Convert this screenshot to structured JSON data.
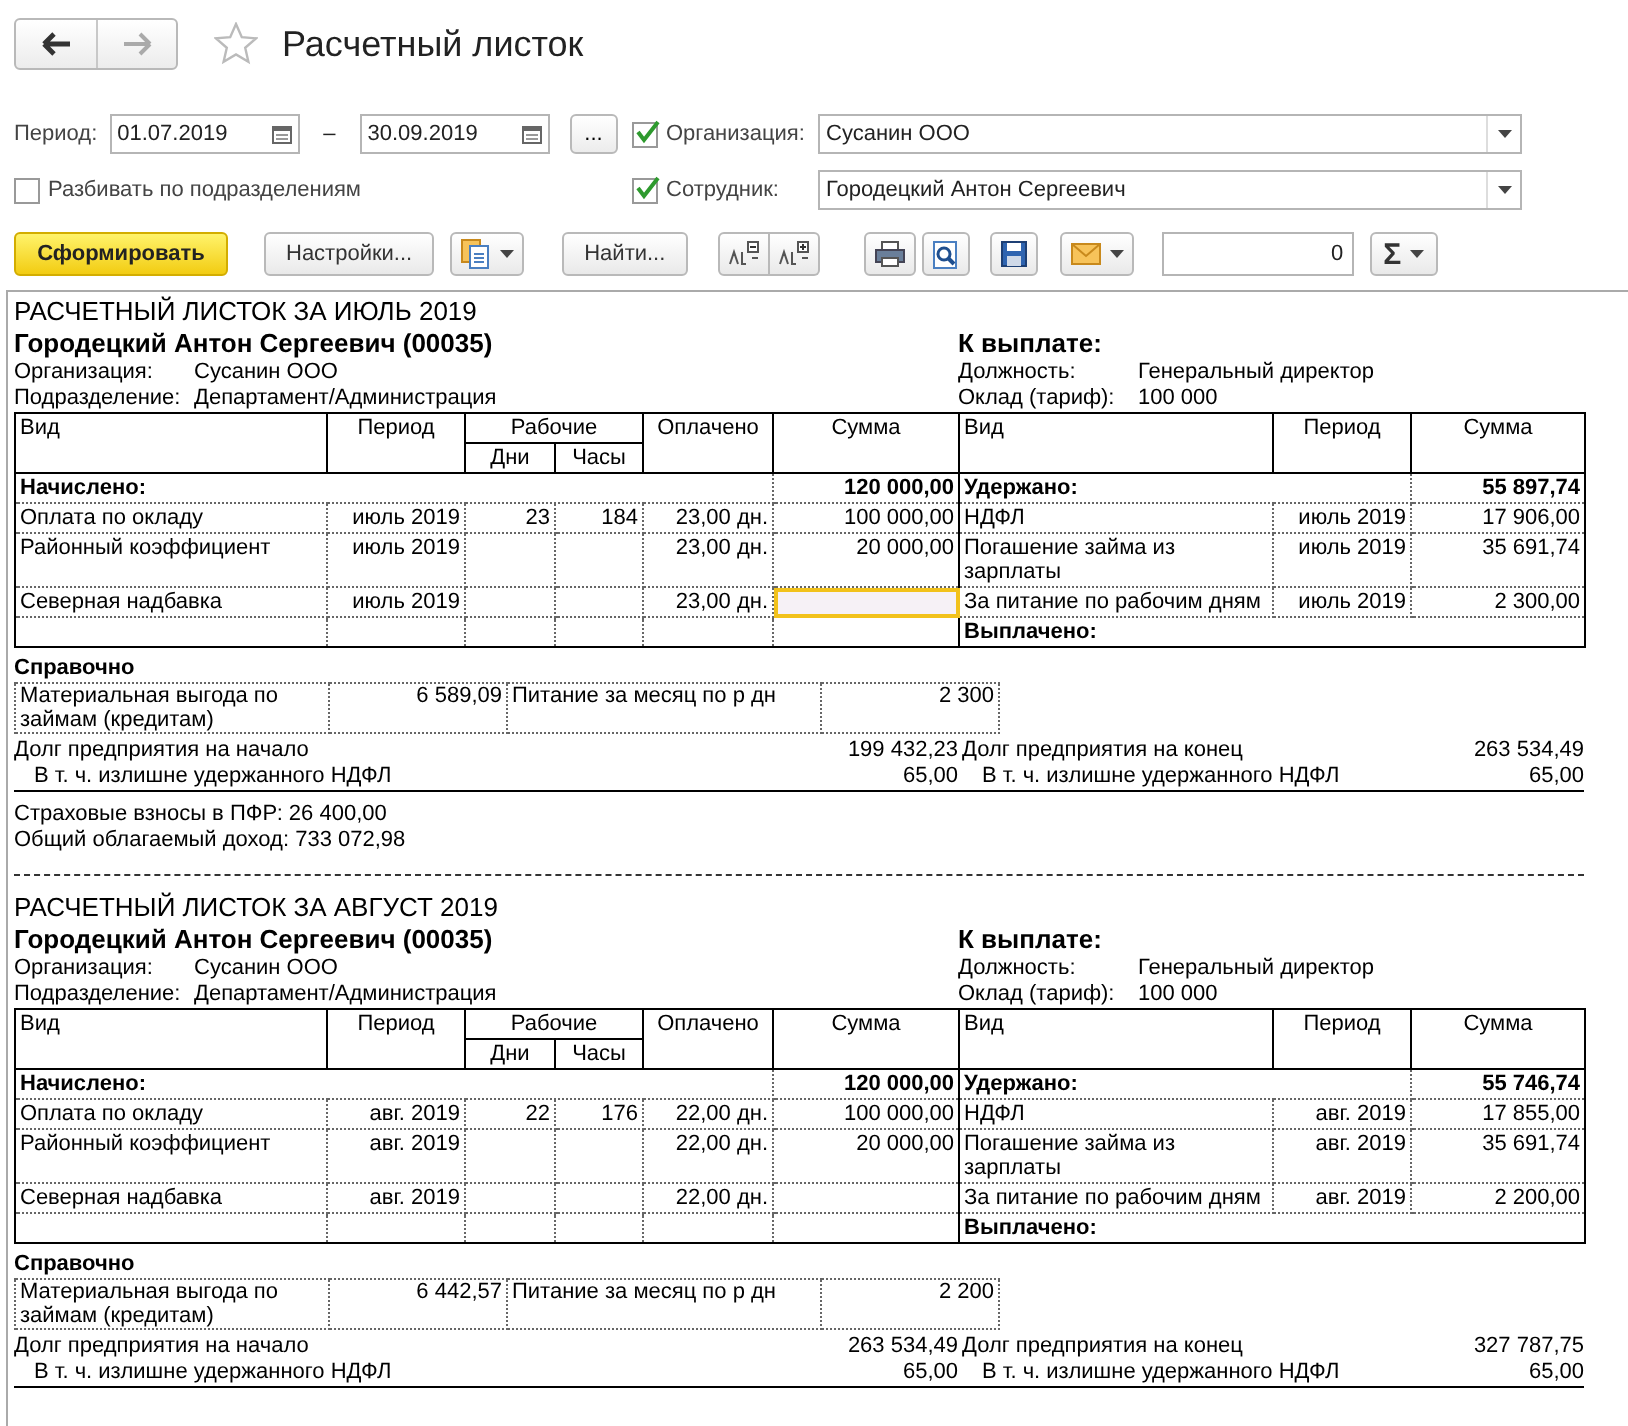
{
  "window": {
    "title": "Расчетный листок"
  },
  "filters": {
    "period_label": "Период:",
    "date_from": "01.07.2019",
    "dash": "–",
    "date_to": "30.09.2019",
    "more_button": "...",
    "organization": {
      "label": "Организация:",
      "checked": true,
      "value": "Сусанин ООО"
    },
    "employee": {
      "label": "Сотрудник:",
      "checked": true,
      "value": "Городецкий Антон Сергеевич"
    },
    "split_by_departments": {
      "label": "Разбивать по подразделениям",
      "checked": false
    }
  },
  "toolbar": {
    "generate_button": "Сформировать",
    "settings_button": "Настройки...",
    "find_button": "Найти...",
    "counter_value": "0",
    "sum_button": "Σ"
  },
  "sheets": [
    {
      "title": "РАСЧЕТНЫЙ ЛИСТОК ЗА ИЮЛЬ 2019",
      "employee": "Городецкий Антон Сергеевич (00035)",
      "to_pay_label": "К выплате:",
      "organization": {
        "label": "Организация:",
        "value": "Сусанин ООО"
      },
      "position": {
        "label": "Должность:",
        "value": "Генеральный директор"
      },
      "department": {
        "label": "Подразделение:",
        "value": "Департамент/Администрация"
      },
      "salary": {
        "label": "Оклад (тариф):",
        "value": "100 000"
      },
      "columns": {
        "type": "Вид",
        "period": "Период",
        "working": "Рабочие",
        "days": "Дни",
        "hours": "Часы",
        "paid": "Оплачено",
        "sum": "Сумма",
        "type_2": "Вид",
        "period_2": "Период",
        "sum_2": "Сумма"
      },
      "accrued": {
        "label": "Начислено:",
        "total": "120 000,00"
      },
      "withheld": {
        "label": "Удержано:",
        "total": "55 897,74"
      },
      "accruals": [
        {
          "type": "Оплата по окладу",
          "period": "июль 2019",
          "days": "23",
          "hours": "184",
          "paid": "23,00 дн.",
          "sum": "100 000,00",
          "selected": false
        },
        {
          "type": "Районный коэффициент",
          "period": "июль 2019",
          "paid": "23,00 дн.",
          "sum": "20 000,00",
          "selected": false
        },
        {
          "type": "Северная надбавка",
          "period": "июль 2019",
          "paid": "23,00 дн.",
          "selected": true
        }
      ],
      "deductions": [
        {
          "type": "НДФЛ",
          "period": "июль 2019",
          "sum": "17 906,00"
        },
        {
          "type": "Погашение займа из зарплаты",
          "period": "июль 2019",
          "sum": "35 691,74"
        },
        {
          "type": "За питание по рабочим дням",
          "period": "июль 2019",
          "sum": "2 300,00"
        }
      ],
      "paid_out_label": "Выплачено:",
      "reference": {
        "label": "Справочно",
        "items": [
          {
            "label": "Материальная выгода по займам (кредитам)",
            "value": "6 589,09"
          },
          {
            "label": "Питание за месяц по р дн",
            "value": "2 300"
          }
        ]
      },
      "debt_start": {
        "label": "Долг предприятия на начало",
        "value": "199 432,23"
      },
      "debt_end": {
        "label": "Долг предприятия на конец",
        "value": "263 534,49"
      },
      "debt_start_ndfl": {
        "label": "В т. ч. излишне удержанного НДФЛ",
        "value": "65,00"
      },
      "debt_end_ndfl": {
        "label": "В т. ч. излишне удержанного НДФЛ",
        "value": "65,00"
      },
      "footer": [
        "Страховые взносы в ПФР: 26 400,00",
        "Общий облагаемый доход: 733 072,98"
      ]
    },
    {
      "title": "РАСЧЕТНЫЙ ЛИСТОК ЗА АВГУСТ 2019",
      "employee": "Городецкий Антон Сергеевич (00035)",
      "to_pay_label": "К выплате:",
      "organization": {
        "label": "Организация:",
        "value": "Сусанин ООО"
      },
      "position": {
        "label": "Должность:",
        "value": "Генеральный директор"
      },
      "department": {
        "label": "Подразделение:",
        "value": "Департамент/Администрация"
      },
      "salary": {
        "label": "Оклад (тариф):",
        "value": "100 000"
      },
      "columns": {
        "type": "Вид",
        "period": "Период",
        "working": "Рабочие",
        "days": "Дни",
        "hours": "Часы",
        "paid": "Оплачено",
        "sum": "Сумма",
        "type_2": "Вид",
        "period_2": "Период",
        "sum_2": "Сумма"
      },
      "accrued": {
        "label": "Начислено:",
        "total": "120 000,00"
      },
      "withheld": {
        "label": "Удержано:",
        "total": "55 746,74"
      },
      "accruals": [
        {
          "type": "Оплата по окладу",
          "period": "авг. 2019",
          "days": "22",
          "hours": "176",
          "paid": "22,00 дн.",
          "sum": "100 000,00",
          "selected": false
        },
        {
          "type": "Районный коэффициент",
          "period": "авг. 2019",
          "paid": "22,00 дн.",
          "sum": "20 000,00",
          "selected": false
        },
        {
          "type": "Северная надбавка",
          "period": "авг. 2019",
          "paid": "22,00 дн.",
          "selected": false
        }
      ],
      "deductions": [
        {
          "type": "НДФЛ",
          "period": "авг. 2019",
          "sum": "17 855,00"
        },
        {
          "type": "Погашение займа из зарплаты",
          "period": "авг. 2019",
          "sum": "35 691,74"
        },
        {
          "type": "За питание по рабочим дням",
          "period": "авг. 2019",
          "sum": "2 200,00"
        }
      ],
      "paid_out_label": "Выплачено:",
      "reference": {
        "label": "Справочно",
        "items": [
          {
            "label": "Материальная выгода по займам (кредитам)",
            "value": "6 442,57"
          },
          {
            "label": "Питание за месяц по р дн",
            "value": "2 200"
          }
        ]
      },
      "debt_start": {
        "label": "Долг предприятия на начало",
        "value": "263 534,49"
      },
      "debt_end": {
        "label": "Долг предприятия на конец",
        "value": "327 787,75"
      },
      "debt_start_ndfl": {
        "label": "В т. ч. излишне удержанного НДФЛ",
        "value": "65,00"
      },
      "debt_end_ndfl": {
        "label": "В т. ч. излишне удержанного НДФЛ",
        "value": "65,00"
      }
    }
  ]
}
